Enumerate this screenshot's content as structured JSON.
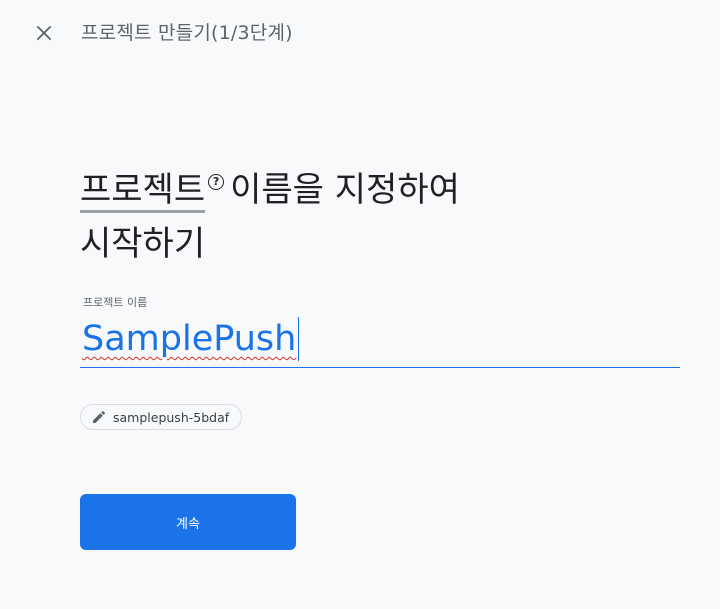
{
  "header": {
    "close_icon": "close-icon",
    "title": "프로젝트 만들기(1/3단계)"
  },
  "heading": {
    "term": "프로젝트",
    "help_icon": "help-circle-icon",
    "help_glyph": "?",
    "rest_line1": "이름을 지정하여",
    "line2": "시작하기"
  },
  "project_name": {
    "label": "프로젝트 이름",
    "value": "SamplePush"
  },
  "project_id_chip": {
    "icon": "pencil-icon",
    "value": "samplepush-5bdaf"
  },
  "continue_button": {
    "label": "계속"
  },
  "colors": {
    "accent": "#1a73e8",
    "background": "#f8f9fa",
    "spellcheck": "#d93025"
  }
}
